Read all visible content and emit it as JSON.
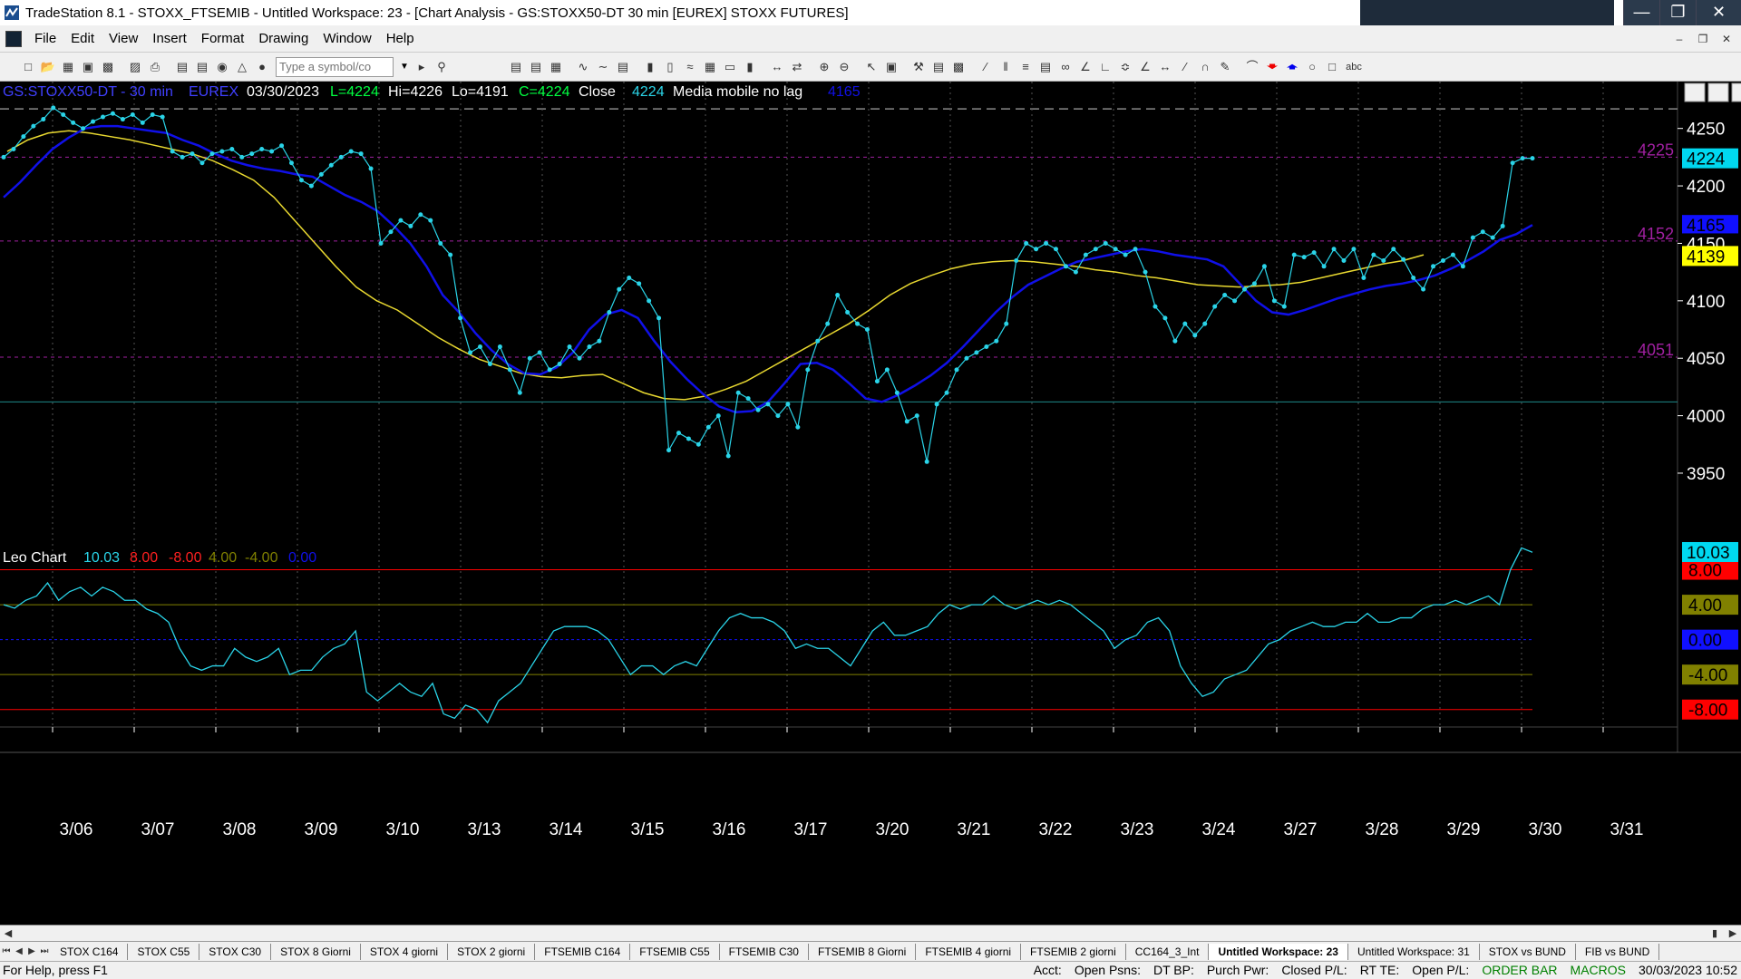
{
  "window": {
    "title": "TradeStation 8.1 - STOXX_FTSEMIB - Untitled Workspace:  23 - [Chart Analysis - GS:STOXX50-DT  30 min  [EUREX] STOXX FUTURES]",
    "controls": [
      "minimize",
      "maximize",
      "close"
    ]
  },
  "menu": {
    "items": [
      "File",
      "Edit",
      "View",
      "Insert",
      "Format",
      "Drawing",
      "Window",
      "Help"
    ]
  },
  "toolbar": {
    "symbol_placeholder": "Type a symbol/co"
  },
  "chart_data": [
    {
      "type": "line",
      "header": {
        "symbol": "GS:STOXX50-DT - 30 min",
        "exchange": "EUREX",
        "date": "03/30/2023",
        "last": "L=4224",
        "high": "Hi=4226",
        "low": "Lo=4191",
        "close": "C=4224",
        "close_label": "Close",
        "close_value": "4224",
        "ma_label": "Media mobile no lag",
        "ma_value": "4165"
      },
      "ylim": [
        3920,
        4275
      ],
      "yticks": [
        "4250",
        "4200",
        "4150",
        "4100",
        "4050",
        "4000",
        "3950"
      ],
      "ytick_values": [
        4250,
        4200,
        4150,
        4100,
        4050,
        4000,
        3950
      ],
      "reference_lines": [
        {
          "label": "4225",
          "value": 4225,
          "color": "#a020a0"
        },
        {
          "label": "4152",
          "value": 4152,
          "color": "#a020a0"
        },
        {
          "label": "4051",
          "value": 4051,
          "color": "#a020a0"
        }
      ],
      "horizontal_line": 4012,
      "badges": [
        {
          "text": "4224",
          "value": 4224,
          "bg": "#00d8f0",
          "fg": "#000"
        },
        {
          "text": "4165",
          "value": 4166,
          "bg": "#1010ff",
          "fg": "#000"
        },
        {
          "text": "4150",
          "value": 4150,
          "bg": "#000",
          "fg": "#fff"
        },
        {
          "text": "4139",
          "value": 4139,
          "bg": "#ffff00",
          "fg": "#000"
        }
      ],
      "series": [
        {
          "name": "Close",
          "color": "#2ad4e8",
          "values": [
            4225,
            4232,
            4243,
            4252,
            4258,
            4268,
            4262,
            4255,
            4250,
            4256,
            4260,
            4263,
            4258,
            4262,
            4255,
            4262,
            4260,
            4230,
            4225,
            4228,
            4220,
            4228,
            4230,
            4232,
            4225,
            4228,
            4232,
            4230,
            4235,
            4220,
            4205,
            4200,
            4210,
            4218,
            4225,
            4230,
            4228,
            4215,
            4150,
            4160,
            4170,
            4165,
            4175,
            4170,
            4150,
            4140,
            4085,
            4055,
            4060,
            4045,
            4060,
            4040,
            4020,
            4050,
            4055,
            4040,
            4045,
            4060,
            4050,
            4060,
            4065,
            4090,
            4110,
            4120,
            4115,
            4100,
            4085,
            3970,
            3985,
            3980,
            3975,
            3990,
            4000,
            3965,
            4020,
            4015,
            4005,
            4010,
            4000,
            4010,
            3990,
            4040,
            4065,
            4080,
            4105,
            4090,
            4080,
            4075,
            4030,
            4040,
            4020,
            3995,
            4000,
            3960,
            4010,
            4020,
            4040,
            4050,
            4055,
            4060,
            4065,
            4080,
            4135,
            4150,
            4145,
            4150,
            4145,
            4130,
            4125,
            4140,
            4145,
            4150,
            4145,
            4140,
            4145,
            4125,
            4095,
            4085,
            4065,
            4080,
            4070,
            4080,
            4095,
            4105,
            4100,
            4110,
            4115,
            4130,
            4100,
            4095,
            4140,
            4138,
            4142,
            4130,
            4145,
            4135,
            4145,
            4120,
            4140,
            4135,
            4145,
            4136,
            4120,
            4110,
            4130,
            4135,
            4140,
            4130,
            4155,
            4160,
            4155,
            4165,
            4220,
            4224,
            4224
          ]
        },
        {
          "name": "Media mobile no lag",
          "color": "#1010e8",
          "values": [
            4190,
            4203,
            4218,
            4232,
            4242,
            4250,
            4252,
            4252,
            4250,
            4248,
            4246,
            4240,
            4235,
            4228,
            4222,
            4218,
            4215,
            4213,
            4210,
            4208,
            4200,
            4192,
            4186,
            4178,
            4165,
            4150,
            4130,
            4105,
            4090,
            4072,
            4057,
            4045,
            4037,
            4036,
            4042,
            4055,
            4075,
            4088,
            4092,
            4085,
            4065,
            4047,
            4032,
            4019,
            4008,
            4003,
            4004,
            4012,
            4028,
            4045,
            4046,
            4040,
            4028,
            4015,
            4012,
            4018,
            4026,
            4035,
            4046,
            4060,
            4075,
            4090,
            4103,
            4114,
            4121,
            4128,
            4134,
            4137,
            4140,
            4143,
            4145,
            4143,
            4140,
            4138,
            4136,
            4130,
            4115,
            4100,
            4090,
            4088,
            4092,
            4097,
            4102,
            4106,
            4110,
            4113,
            4115,
            4118,
            4122,
            4128,
            4135,
            4143,
            4153,
            4158,
            4166
          ]
        },
        {
          "name": "Media 2",
          "color": "#e8d830",
          "values": [
            4230,
            4240,
            4246,
            4248,
            4246,
            4243,
            4240,
            4236,
            4232,
            4228,
            4222,
            4214,
            4205,
            4190,
            4170,
            4150,
            4130,
            4112,
            4100,
            4092,
            4080,
            4068,
            4058,
            4049,
            4043,
            4037,
            4034,
            4033,
            4035,
            4036,
            4028,
            4020,
            4015,
            4014,
            4017,
            4023,
            4030,
            4040,
            4050,
            4060,
            4070,
            4080,
            4092,
            4105,
            4115,
            4122,
            4128,
            4132,
            4134,
            4135,
            4134,
            4132,
            4130,
            4127,
            4125,
            4122,
            4120,
            4117,
            4114,
            4113,
            4112,
            4113,
            4114,
            4116,
            4120,
            4124,
            4128,
            4132,
            4135,
            4140
          ]
        }
      ]
    },
    {
      "type": "line",
      "header": {
        "name": "Leo Chart",
        "v1": "10.03",
        "v2": "8.00",
        "v3": "-8.00",
        "v4": "4.00",
        "v5": "-4.00",
        "v6": "0.00"
      },
      "ylim": [
        -10,
        12
      ],
      "levels": [
        {
          "label": "8.00",
          "value": 8,
          "color": "#ff0000",
          "bg": "#ff0000",
          "fg": "#000"
        },
        {
          "label": "4.00",
          "value": 4,
          "color": "#808000",
          "bg": "#808000",
          "fg": "#000"
        },
        {
          "label": "0.00",
          "value": 0,
          "color": "#1010ff",
          "bg": "#1010ff",
          "fg": "#000"
        },
        {
          "label": "-4.00",
          "value": -4,
          "color": "#808000",
          "bg": "#808000",
          "fg": "#000"
        },
        {
          "label": "-8.00",
          "value": -8,
          "color": "#ff0000",
          "bg": "#ff0000",
          "fg": "#000"
        }
      ],
      "badge": {
        "text": "10.03",
        "value": 10.03
      },
      "series": [
        {
          "name": "Leo Chart",
          "color": "#2ad4e8",
          "values": [
            4,
            3.6,
            4.5,
            5,
            6.5,
            4.5,
            5.5,
            6,
            5,
            6,
            5.5,
            4.5,
            4.5,
            3.5,
            3,
            2,
            -1,
            -3,
            -3.5,
            -3,
            -3,
            -1,
            -2,
            -2.5,
            -2,
            -1,
            -4,
            -3.5,
            -3.5,
            -2,
            -1,
            -0.5,
            1,
            -6,
            -7,
            -6,
            -5,
            -6,
            -6.5,
            -5,
            -8.5,
            -9,
            -7.5,
            -8,
            -9.5,
            -7,
            -6,
            -5,
            -3,
            -1,
            1,
            1.5,
            1.5,
            1.5,
            1,
            0,
            -2,
            -4,
            -3,
            -3,
            -4,
            -3,
            -2.5,
            -3,
            -1,
            1,
            2.5,
            3,
            2.5,
            2.5,
            2,
            1,
            -1,
            -0.5,
            -1,
            -1,
            -2,
            -3,
            -1,
            1,
            2,
            0.5,
            0.5,
            1,
            1.5,
            3,
            4,
            3.5,
            4,
            4,
            5,
            4,
            3.5,
            4,
            4.5,
            4,
            4.5,
            4,
            3,
            2,
            1,
            -1,
            0,
            0.5,
            2,
            2.5,
            1,
            -3,
            -5,
            -6.5,
            -6,
            -4.5,
            -4,
            -3.5,
            -2,
            -0.5,
            0,
            1,
            1.5,
            2,
            1.5,
            1.5,
            2,
            2,
            3,
            2,
            2,
            2.5,
            2.5,
            3.5,
            4,
            4,
            4.5,
            4,
            4.5,
            5,
            4,
            8,
            10.5,
            10
          ]
        }
      ]
    }
  ],
  "xaxis": {
    "labels": [
      "3/06",
      "3/07",
      "3/08",
      "3/09",
      "3/10",
      "3/13",
      "3/14",
      "3/15",
      "3/16",
      "3/17",
      "3/20",
      "3/21",
      "3/22",
      "3/23",
      "3/24",
      "3/27",
      "3/28",
      "3/29",
      "3/30",
      "3/31"
    ]
  },
  "tabs": {
    "items": [
      "STOX C164",
      "STOX C55",
      "STOX  C30",
      "STOX  8 Giorni",
      "STOX 4 giorni",
      "STOX  2 giorni",
      "FTSEMIB C164",
      "FTSEMIB C55",
      "FTSEMIB C30",
      "FTSEMIB  8 Giorni",
      "FTSEMIB  4 giorni",
      "FTSEMIB  2 giorni",
      "CC164_3_Int",
      "Untitled Workspace:  23",
      "Untitled Workspace:  31",
      "STOX vs BUND",
      "FIB vs BUND"
    ],
    "active_index": 13
  },
  "status": {
    "help": "For Help, press F1",
    "acct": "Acct:",
    "open_psns": "Open Psns:",
    "dt_bp": "DT BP:",
    "purch_pwr": "Purch Pwr:",
    "closed_pl": "Closed P/L:",
    "rt_te": "RT TE:",
    "open_pl": "Open P/L:",
    "order_bar": "ORDER BAR",
    "macros": "MACROS",
    "datetime": "30/03/2023 10:52"
  }
}
